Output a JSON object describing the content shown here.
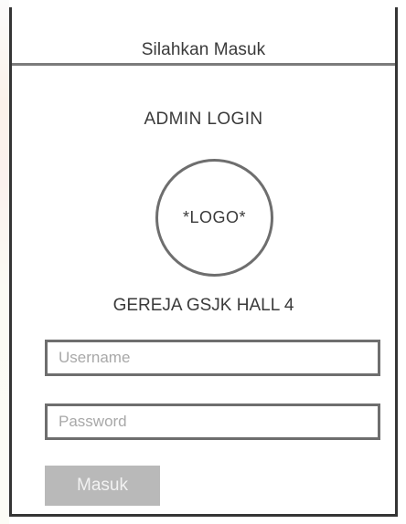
{
  "header": {
    "title": "Silahkan Masuk"
  },
  "login": {
    "heading": "ADMIN LOGIN",
    "logo_text": "*LOGO*",
    "organization": "GEREJA GSJK HALL 4",
    "username": {
      "placeholder": "Username",
      "value": ""
    },
    "password": {
      "placeholder": "Password",
      "value": ""
    },
    "submit_label": "Masuk"
  },
  "colors": {
    "frame_border": "#353535",
    "field_border": "#6e6e6e",
    "button_bg": "#b9b9b9",
    "button_text": "#f2f2f2",
    "text": "#3a3a3a",
    "placeholder": "#a8a8a8"
  }
}
